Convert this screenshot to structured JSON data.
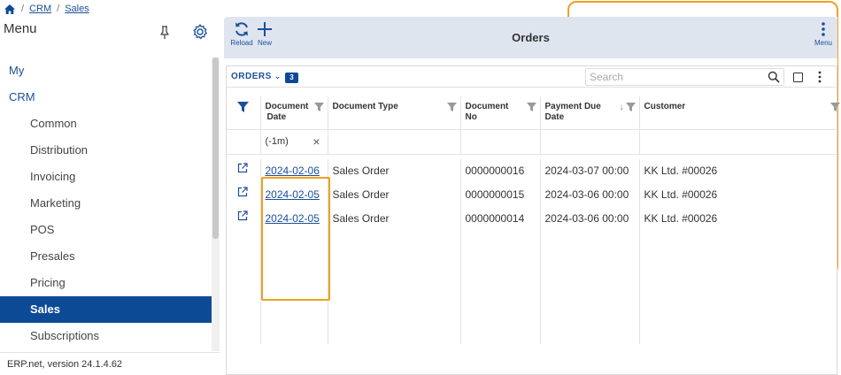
{
  "breadcrumb": {
    "items": [
      "CRM",
      "Sales"
    ]
  },
  "sidebar": {
    "title": "Menu",
    "items": [
      {
        "label": "My"
      },
      {
        "label": "CRM"
      },
      {
        "label": "Common"
      },
      {
        "label": "Distribution"
      },
      {
        "label": "Invoicing"
      },
      {
        "label": "Marketing"
      },
      {
        "label": "POS"
      },
      {
        "label": "Presales"
      },
      {
        "label": "Pricing"
      },
      {
        "label": "Sales"
      },
      {
        "label": "Subscriptions"
      }
    ],
    "footer": "ERP.net, version 24.1.4.62"
  },
  "toolbar": {
    "reload_label": "Reload",
    "new_label": "New",
    "title": "Orders",
    "menu_label": "Menu"
  },
  "grid": {
    "label": "ORDERS",
    "count": "3",
    "search_placeholder": "Search",
    "columns": {
      "document_date": [
        "Document",
        "Date"
      ],
      "document_type": "Document Type",
      "document_no": [
        "Document",
        "No"
      ],
      "payment_due_date": [
        "Payment Due",
        "Date"
      ],
      "customer": "Customer"
    },
    "filter_value": "(-1m)",
    "clear_glyph": "×",
    "rows": [
      {
        "date": "2024-02-06",
        "type": "Sales Order",
        "no": "0000000016",
        "due": "2024-03-07 00:00",
        "customer": "KK Ltd. #00026"
      },
      {
        "date": "2024-02-05",
        "type": "Sales Order",
        "no": "0000000015",
        "due": "2024-03-06 00:00",
        "customer": "KK Ltd. #00026"
      },
      {
        "date": "2024-02-05",
        "type": "Sales Order",
        "no": "0000000014",
        "due": "2024-03-06 00:00",
        "customer": "KK Ltd. #00026"
      }
    ]
  },
  "colors": {
    "primary": "#0d4a96",
    "link": "#1b4f9c",
    "toolbar_bg": "#dfe5ef",
    "highlight": "#f0a020"
  }
}
